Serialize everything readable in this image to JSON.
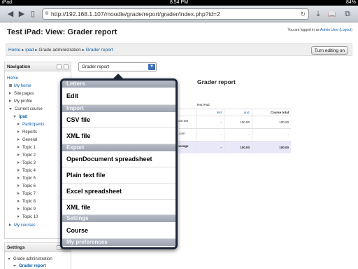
{
  "status": {
    "carrier": "iPad",
    "time": "8:54 PM",
    "battery": "84%"
  },
  "toolbar": {
    "url": "http://192.168.1.107/moodle/grade/report/grader/index.php?id=2",
    "back_glyph": "◀",
    "forward_glyph": "▶",
    "bookmarks_glyph": "▯",
    "add_glyph": "+",
    "reload_glyph": "↻",
    "download_glyph": "⤓",
    "reading_glyph": "📖",
    "tabs_glyph": "⧉",
    "globe_glyph": "⊕"
  },
  "header": {
    "title": "Test iPad: View: Grader report",
    "login_prefix": "You are logged in as",
    "login_user": "Admin User",
    "logout": "(Logout)"
  },
  "breadcrumb": {
    "home": "Home",
    "sep": "▸",
    "course": "ipad",
    "admin": "Grade administration",
    "report": "Grader report"
  },
  "turn_editing": "Turn editing on",
  "navigation": {
    "title": "Navigation",
    "items": [
      {
        "label": "Home"
      },
      {
        "label": "My home"
      },
      {
        "label": "Site pages"
      },
      {
        "label": "My profile"
      },
      {
        "label": "Current course"
      },
      {
        "label": "ipad"
      },
      {
        "label": "Participants"
      },
      {
        "label": "Reports"
      },
      {
        "label": "General"
      },
      {
        "label": "Topic 1"
      },
      {
        "label": "Topic 2"
      },
      {
        "label": "Topic 3"
      },
      {
        "label": "Topic 4"
      },
      {
        "label": "Topic 5"
      },
      {
        "label": "Topic 6"
      },
      {
        "label": "Topic 7"
      },
      {
        "label": "Topic 8"
      },
      {
        "label": "Topic 9"
      },
      {
        "label": "Topic 10"
      },
      {
        "label": "My courses"
      }
    ]
  },
  "settings": {
    "title": "Settings",
    "items": [
      {
        "label": "Grade administration"
      },
      {
        "label": "Grader report"
      }
    ]
  },
  "grader_select": {
    "value": "Grader report",
    "arrow": "▼"
  },
  "grader_heading": "Grader report",
  "grade_table": {
    "course_label": "Test iPad",
    "headers": [
      "test",
      "quiz",
      "Course total"
    ],
    "rows": [
      {
        "label": "ore.net",
        "values": [
          "-",
          "100.00",
          "100.00"
        ]
      },
      {
        "label": ".com",
        "values": [
          "-",
          "-",
          "-"
        ]
      },
      {
        "label": "verage",
        "values": [
          "-",
          "100.00",
          "100.00"
        ]
      }
    ]
  },
  "popover": {
    "sections": [
      {
        "title": "Letters",
        "items": [
          "Edit"
        ]
      },
      {
        "title": "Import",
        "items": [
          "CSV file",
          "XML file"
        ]
      },
      {
        "title": "Export",
        "items": [
          "OpenDocument spreadsheet",
          "Plain text file",
          "Excel spreadsheet",
          "XML file"
        ]
      },
      {
        "title": "Settings",
        "items": [
          "Course"
        ]
      },
      {
        "title": "My preferences",
        "items": []
      }
    ]
  }
}
